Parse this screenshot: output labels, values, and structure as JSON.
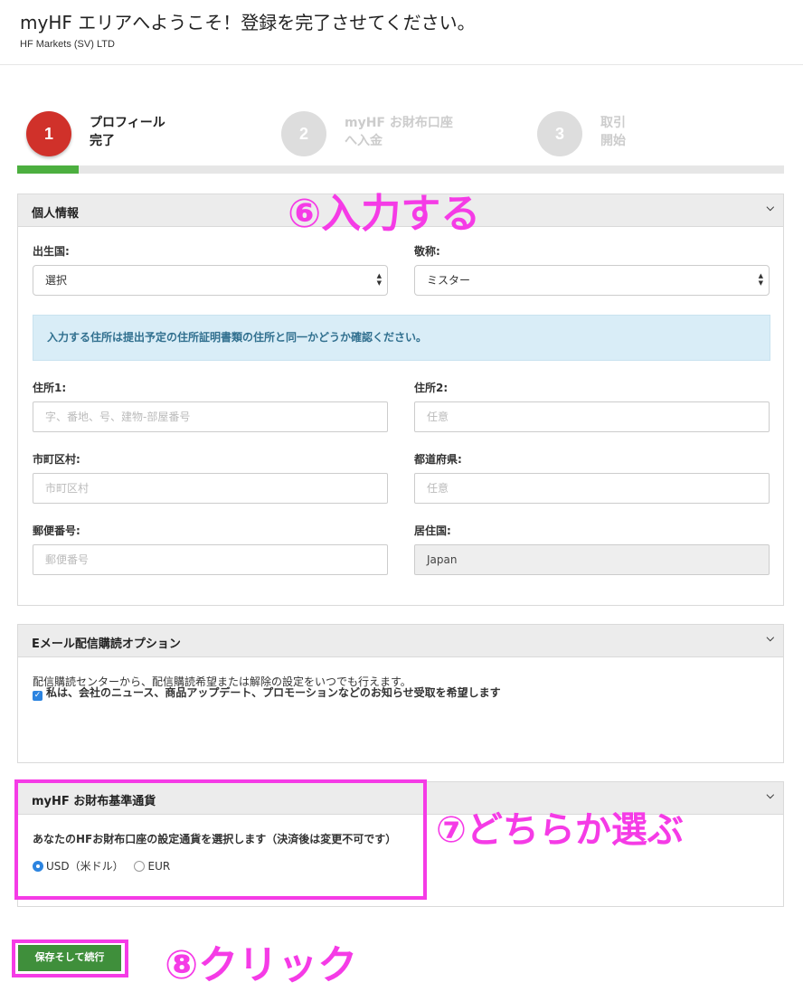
{
  "header": {
    "title": "myHF エリアへようこそ！登録を完了させてください。",
    "company": "HF Markets (SV) LTD"
  },
  "steps": [
    {
      "number": "1",
      "line1": "プロフィール",
      "line2": "完了",
      "active": true
    },
    {
      "number": "2",
      "line1": "myHF お財布口座",
      "line2": "へ入金",
      "active": false
    },
    {
      "number": "3",
      "line1": "取引",
      "line2": "開始",
      "active": false
    }
  ],
  "progress": {
    "fraction": 0.08
  },
  "personal": {
    "title": "個人情報",
    "birth_country_label": "出生国:",
    "birth_country_value": "選択",
    "salutation_label": "敬称:",
    "salutation_value": "ミスター",
    "info_text": "入力する住所は提出予定の住所証明書類の住所と同一かどうか確認ください。",
    "address1_label": "住所1:",
    "address1_placeholder": "字、番地、号、建物-部屋番号",
    "address2_label": "住所2:",
    "address2_placeholder": "任意",
    "city_label": "市町区村:",
    "city_placeholder": "市町区村",
    "prefecture_label": "都道府県:",
    "prefecture_placeholder": "任意",
    "postal_label": "郵便番号:",
    "postal_placeholder": "郵便番号",
    "residence_label": "居住国:",
    "residence_value": "Japan"
  },
  "email": {
    "title": "Eメール配信購読オプション",
    "description": "配信購読センターから、配信購読希望または解除の設定をいつでも行えます。",
    "checkbox_label": "私は、会社のニュース、商品アップデート、プロモーションなどのお知らせ受取を希望します",
    "checked": true
  },
  "currency": {
    "title": "myHF お財布基準通貨",
    "description": "あなたのHFお財布口座の設定通貨を選択します（決済後は変更不可です）",
    "usd_label": "USD（米ドル）",
    "eur_label": "EUR",
    "selected": "USD"
  },
  "submit_label": "保存そして続行",
  "annotations": {
    "a6": "⑥入力する",
    "a7": "⑦どちらか選ぶ",
    "a8": "⑧クリック"
  },
  "icons": {
    "chevron": "chevron-down-icon",
    "select_arrows": "select-arrows-icon",
    "check": "checkmark-icon"
  },
  "colors": {
    "active_step": "#d0312a",
    "progress": "#4caf3f",
    "info_bg": "#d9edf7",
    "info_text": "#31708f",
    "highlight": "#f53be6",
    "button": "#3f8f3b",
    "radio_on": "#2c84e0"
  }
}
